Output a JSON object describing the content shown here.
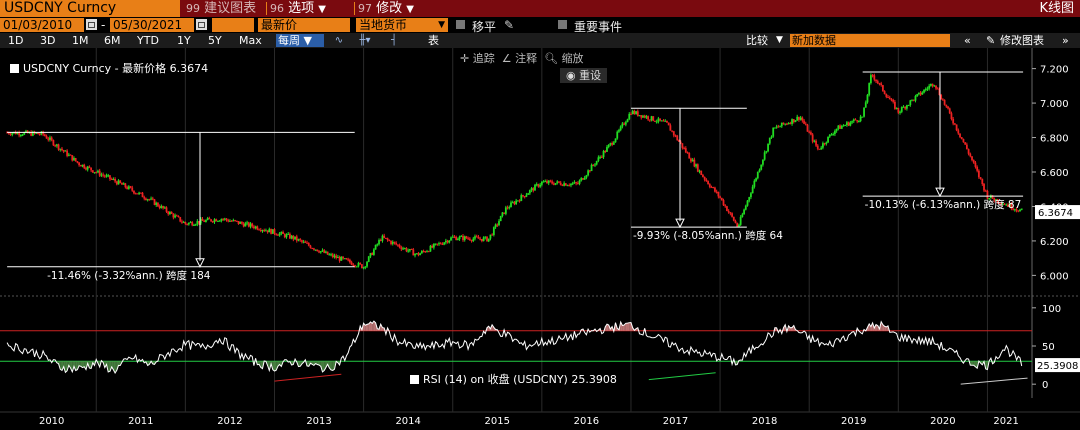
{
  "titlebar": {
    "ticker": "USDCNY Curncy",
    "tab1_num": "99",
    "tab1_label": "建议图表",
    "tab2_num": "96",
    "tab2_label": "选项",
    "tab3_num": "97",
    "tab3_label": "修改",
    "window_title": "K线图"
  },
  "range": {
    "start_date": "01/03/2010",
    "end_date": "05/30/2021",
    "dash": "-",
    "price_field": "最新价",
    "currency_field": "当地货币",
    "shift_label": "移平",
    "events_label": "重要事件"
  },
  "toolbar": {
    "periods": [
      "1D",
      "3D",
      "1M",
      "6M",
      "YTD",
      "1Y",
      "5Y",
      "Max"
    ],
    "frequency": "每周 ▼",
    "table_label": "表",
    "compare_label": "比较",
    "add_data_placeholder": "新加数据",
    "edit_chart_label": "修改图表"
  },
  "chart_tools": {
    "track": "追踪",
    "annotate": "注释",
    "zoom": "缩放",
    "reset": "重设"
  },
  "colors": {
    "up": "#22dd22",
    "down": "#ee2222",
    "accent": "#e87f17",
    "header_bg": "#7a0a0f"
  },
  "chart_data": [
    {
      "type": "candlestick",
      "legend": "USDCNY Curncy - 最新价格 6.3674",
      "last_value": "6.3674",
      "ylim": [
        5.95,
        7.25
      ],
      "yticks": [
        "6.000",
        "6.200",
        "6.400",
        "6.600",
        "6.800",
        "7.000",
        "7.200"
      ],
      "xticks": [
        "2010",
        "2011",
        "2012",
        "2013",
        "2014",
        "2015",
        "2016",
        "2017",
        "2018",
        "2019",
        "2020",
        "2021"
      ],
      "x": [
        2010.0,
        2010.4,
        2010.8,
        2011.2,
        2011.6,
        2012.0,
        2012.4,
        2012.8,
        2013.2,
        2013.6,
        2014.0,
        2014.2,
        2014.6,
        2015.0,
        2015.4,
        2015.6,
        2016.0,
        2016.4,
        2016.8,
        2017.0,
        2017.4,
        2017.8,
        2018.0,
        2018.2,
        2018.6,
        2018.9,
        2019.1,
        2019.3,
        2019.6,
        2019.7,
        2020.0,
        2020.4,
        2020.8,
        2021.0,
        2021.4
      ],
      "y": [
        6.83,
        6.82,
        6.65,
        6.55,
        6.44,
        6.3,
        6.33,
        6.28,
        6.22,
        6.12,
        6.05,
        6.22,
        6.12,
        6.22,
        6.21,
        6.39,
        6.54,
        6.53,
        6.78,
        6.95,
        6.88,
        6.58,
        6.45,
        6.28,
        6.85,
        6.92,
        6.73,
        6.85,
        6.92,
        7.17,
        6.95,
        7.12,
        6.7,
        6.46,
        6.37
      ],
      "annotations": [
        {
          "text": "-11.46% (-3.32%ann.) 跨度 184",
          "x_from": 2010.0,
          "x_to": 2013.9,
          "y_high": 6.83,
          "y_low": 6.05
        },
        {
          "text": "-9.93% (-8.05%ann.) 跨度 64",
          "x_from": 2017.0,
          "x_to": 2018.3,
          "y_high": 6.97,
          "y_low": 6.28
        },
        {
          "text": "-10.13% (-6.13%ann.) 跨度 87",
          "x_from": 2019.6,
          "x_to": 2021.4,
          "y_high": 7.18,
          "y_low": 6.46
        }
      ]
    },
    {
      "type": "line",
      "legend": "RSI (14) on 收盘 (USDCNY) 25.3908",
      "last_value": "25.3908",
      "ylim": [
        -5,
        105
      ],
      "yticks": [
        "0",
        "50",
        "100"
      ],
      "upper_band": 70,
      "lower_band": 30,
      "x": [
        2010.0,
        2010.2,
        2010.4,
        2010.6,
        2010.8,
        2011.0,
        2011.2,
        2011.4,
        2011.6,
        2011.8,
        2012.0,
        2012.2,
        2012.4,
        2012.6,
        2012.8,
        2013.0,
        2013.2,
        2013.4,
        2013.6,
        2013.8,
        2014.0,
        2014.2,
        2014.4,
        2014.6,
        2014.8,
        2015.0,
        2015.2,
        2015.4,
        2015.6,
        2015.8,
        2016.0,
        2016.2,
        2016.4,
        2016.6,
        2016.8,
        2017.0,
        2017.2,
        2017.4,
        2017.6,
        2017.8,
        2018.0,
        2018.2,
        2018.4,
        2018.6,
        2018.8,
        2019.0,
        2019.2,
        2019.4,
        2019.6,
        2019.8,
        2020.0,
        2020.2,
        2020.4,
        2020.6,
        2020.8,
        2021.0,
        2021.2,
        2021.4
      ],
      "y": [
        52,
        45,
        38,
        22,
        20,
        28,
        18,
        35,
        25,
        40,
        52,
        48,
        60,
        40,
        28,
        22,
        30,
        25,
        20,
        35,
        80,
        75,
        55,
        48,
        50,
        55,
        50,
        75,
        65,
        50,
        55,
        58,
        65,
        70,
        75,
        78,
        65,
        55,
        45,
        40,
        35,
        28,
        50,
        68,
        75,
        60,
        50,
        62,
        72,
        78,
        62,
        58,
        55,
        42,
        28,
        25,
        48,
        25
      ]
    }
  ]
}
